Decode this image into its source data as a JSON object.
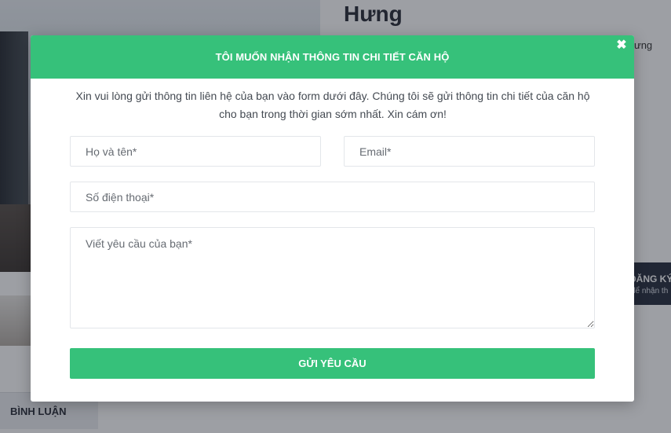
{
  "background": {
    "title": "Hưng",
    "side_text": "ưng",
    "register": {
      "title": "ĐĂNG KÝ",
      "subtitle": "để nhận th"
    },
    "comment_tab": "BÌNH LUẬN"
  },
  "modal": {
    "title": "TÔI MUỐN NHẬN THÔNG TIN CHI TIẾT CĂN HỘ",
    "close_icon": "close-x-icon",
    "intro": "Xin vui lòng gửi thông tin liên hệ của bạn vào form dưới đây. Chúng tôi sẽ gửi thông tin chi tiết của căn hộ cho bạn trong thời gian sớm nhất. Xin cám ơn!",
    "fields": {
      "name_placeholder": "Họ và tên*",
      "name_value": "",
      "email_placeholder": "Email*",
      "email_value": "",
      "phone_placeholder": "Số điện thoại*",
      "phone_value": "",
      "message_placeholder": "Viết yêu cầu của bạn*",
      "message_value": ""
    },
    "submit_label": "GỬI YÊU CẦU"
  },
  "colors": {
    "accent": "#36c17a",
    "overlay": "rgba(22,26,38,0.42)",
    "dark_panel": "#2a3140"
  }
}
